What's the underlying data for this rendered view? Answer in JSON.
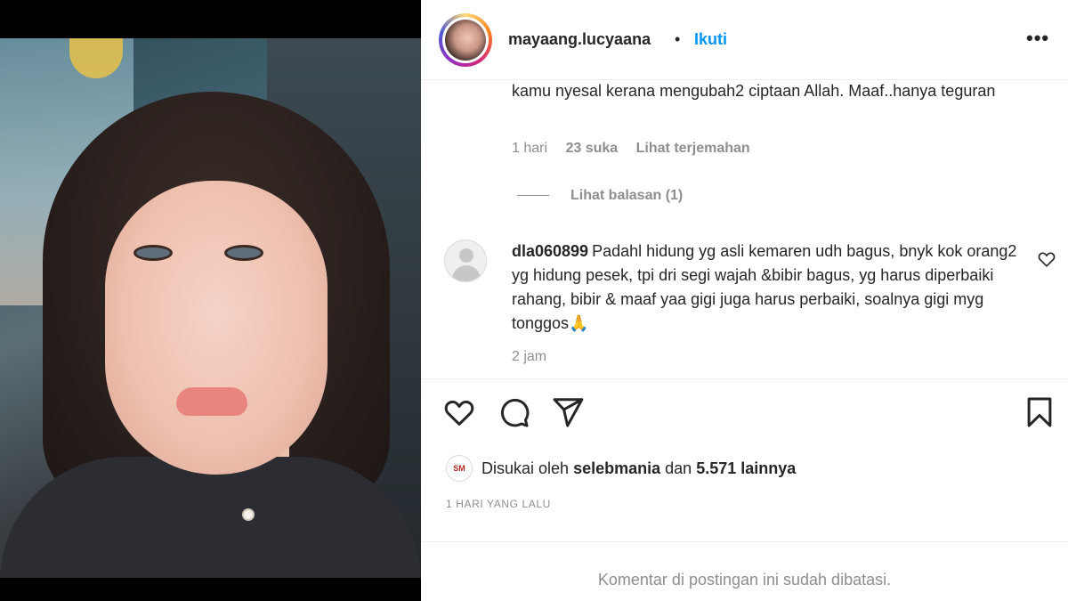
{
  "post": {
    "username": "mayaang.lucyaana",
    "separator": "•",
    "follow_label": "Ikuti",
    "more_label": "•••"
  },
  "comments": [
    {
      "text": "kamu nyesal kerana mengubah2 ciptaan Allah. Maaf..hanya teguran",
      "time": "1 hari",
      "likes": "23 suka",
      "translate_label": "Lihat terjemahan",
      "view_replies_label": "Lihat balasan (1)"
    },
    {
      "author": "dla060899",
      "text": "Padahl hidung yg asli kemaren udh bagus, bnyk kok orang2 yg hidung pesek, tpi dri segi wajah &bibir bagus, yg harus diperbaiki rahang, bibir & maaf yaa gigi juga harus perbaiki, soalnya gigi myg tonggos🙏",
      "time": "2 jam"
    }
  ],
  "likes": {
    "prefix": "Disukai oleh",
    "user": "selebmania",
    "middle": "dan",
    "count": "5.571 lainnya"
  },
  "timestamp": "1 HARI YANG LALU",
  "comments_limited": "Komentar di postingan ini sudah dibatasi.",
  "icons": {
    "like": "heart-icon",
    "comment": "comment-icon",
    "share": "send-icon",
    "save": "bookmark-icon",
    "comment_like": "heart-icon"
  },
  "colors": {
    "link": "#0095f6",
    "muted": "#8e8e8e",
    "text": "#262626"
  }
}
